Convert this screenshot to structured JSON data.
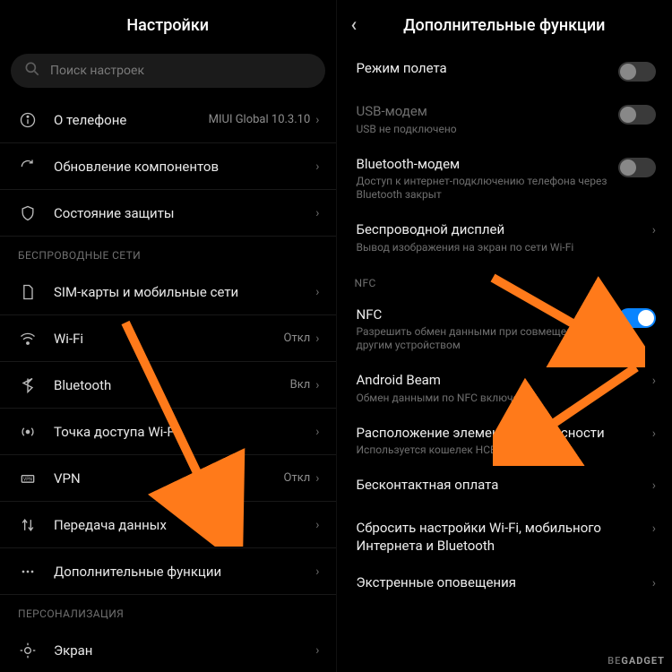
{
  "left": {
    "title": "Настройки",
    "search_placeholder": "Поиск настроек",
    "top": [
      {
        "icon": "info",
        "label": "О телефоне",
        "value": "MIUI Global 10.3.10"
      },
      {
        "icon": "update",
        "label": "Обновление компонентов",
        "value": ""
      },
      {
        "icon": "shield",
        "label": "Состояние защиты",
        "value": ""
      }
    ],
    "section_wireless": "БЕСПРОВОДНЫЕ СЕТИ",
    "wireless": [
      {
        "icon": "sim",
        "label": "SIM-карты и мобильные сети",
        "value": ""
      },
      {
        "icon": "wifi",
        "label": "Wi-Fi",
        "value": "Откл"
      },
      {
        "icon": "bluetooth",
        "label": "Bluetooth",
        "value": "Вкл"
      },
      {
        "icon": "hotspot",
        "label": "Точка доступа Wi-Fi",
        "value": ""
      },
      {
        "icon": "vpn",
        "label": "VPN",
        "value": "Откл"
      },
      {
        "icon": "data",
        "label": "Передача данных",
        "value": ""
      },
      {
        "icon": "more",
        "label": "Дополнительные функции",
        "value": ""
      }
    ],
    "section_personal": "ПЕРСОНАЛИЗАЦИЯ",
    "personal": [
      {
        "icon": "display",
        "label": "Экран",
        "value": ""
      }
    ]
  },
  "right": {
    "title": "Дополнительные функции",
    "items": [
      {
        "title": "Режим полета",
        "sub": "",
        "type": "toggle",
        "on": false,
        "dim": false
      },
      {
        "title": "USB-модем",
        "sub": "USB не подключено",
        "type": "toggle",
        "on": false,
        "dim": true
      },
      {
        "title": "Bluetooth-модем",
        "sub": "Доступ к интернет-подключению телефона через Bluetooth закрыт",
        "type": "toggle",
        "on": false,
        "dim": false
      },
      {
        "title": "Беспроводной дисплей",
        "sub": "Вывод изображения на экран по сети Wi-Fi",
        "type": "link",
        "dim": false
      }
    ],
    "section_nfc": "NFC",
    "nfc_items": [
      {
        "title": "NFC",
        "sub": "Разрешить обмен данными при совмещении с другим устройством",
        "type": "toggle",
        "on": true,
        "dim": false
      },
      {
        "title": "Android Beam",
        "sub": "Обмен данными по NFC включен",
        "type": "link",
        "dim": false
      },
      {
        "title": "Расположение элемента безопасности",
        "sub": "Используется кошелек HCE",
        "type": "link",
        "dim": false
      },
      {
        "title": "Бесконтактная оплата",
        "sub": "",
        "type": "link",
        "dim": false
      },
      {
        "title": "Сбросить настройки Wi-Fi, мобильного Интернета и Bluetooth",
        "sub": "",
        "type": "link",
        "dim": false
      },
      {
        "title": "Экстренные оповещения",
        "sub": "",
        "type": "link",
        "dim": false
      }
    ]
  },
  "watermark": {
    "pre": "BE",
    "bold": "GADGET"
  }
}
